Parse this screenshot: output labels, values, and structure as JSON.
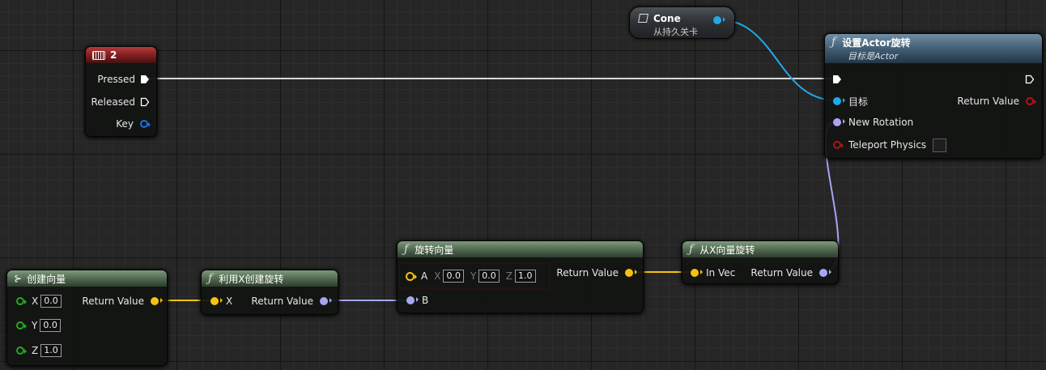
{
  "colors": {
    "exec_wire": "#d8d8d8",
    "vector_wire": "#f5c20e",
    "rotator_wire": "#a6a6f5",
    "object_wire": "#1fa9e8",
    "highlight": "#e2201c"
  },
  "key_event": {
    "title": "2",
    "icon": "keyboard-icon",
    "pins": {
      "pressed": "Pressed",
      "released": "Released",
      "key": "Key"
    }
  },
  "cone": {
    "title": "Cone",
    "subtitle": "从持久关卡",
    "icon": "cube-icon"
  },
  "set_rotation": {
    "title": "设置Actor旋转",
    "subtitle": "目标是Actor",
    "pins": {
      "target": "目标",
      "return_value": "Return Value",
      "new_rotation": "New Rotation",
      "teleport": "Teleport Physics"
    }
  },
  "make_vector": {
    "title": "创建向量",
    "pins": {
      "x": "X",
      "y": "Y",
      "z": "Z",
      "return_value": "Return Value"
    },
    "values": {
      "x": "0.0",
      "y": "0.0",
      "z": "1.0"
    }
  },
  "make_rot_from_x": {
    "title": "利用X创建旋转",
    "pins": {
      "x": "X",
      "return_value": "Return Value"
    }
  },
  "rotate_vector": {
    "title": "旋转向量",
    "pins": {
      "a": "A",
      "b": "B",
      "return_value": "Return Value"
    },
    "axes": {
      "x": "X",
      "y": "Y",
      "z": "Z"
    },
    "values": {
      "x": "0.0",
      "y": "0.0",
      "z": "1.0"
    }
  },
  "rot_from_x_vector": {
    "title": "从X向量旋转",
    "pins": {
      "in_vec": "In Vec",
      "return_value": "Return Value"
    }
  }
}
